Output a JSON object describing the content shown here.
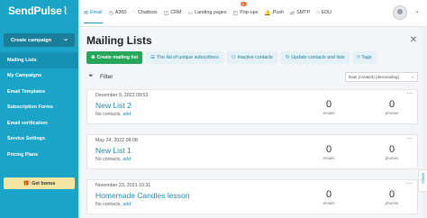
{
  "sidebar": {
    "logo": "SendPulse",
    "create_campaign": "Create campaign",
    "items": [
      {
        "label": "Mailing Lists",
        "active": true
      },
      {
        "label": "My Campaigns",
        "active": false
      },
      {
        "label": "Email Templates",
        "active": false
      },
      {
        "label": "Subscription Forms",
        "active": false
      },
      {
        "label": "Email verification",
        "active": false
      },
      {
        "label": "Service Settings",
        "active": false
      },
      {
        "label": "Pricing Plans",
        "active": false
      }
    ],
    "bonus": "Get bonus"
  },
  "topnav": {
    "items": [
      {
        "label": "Email",
        "icon": "envelope-icon",
        "active": true
      },
      {
        "label": "A360",
        "icon": "a360-icon",
        "active": false
      },
      {
        "label": "Chatbots",
        "icon": "chat-icon",
        "active": false
      },
      {
        "label": "CRM",
        "icon": "crm-icon",
        "active": false
      },
      {
        "label": "Landing pages",
        "icon": "page-icon",
        "active": false
      },
      {
        "label": "Pop-ups",
        "icon": "popup-icon",
        "active": false,
        "badge": "2"
      },
      {
        "label": "Push",
        "icon": "bell-icon",
        "active": false
      },
      {
        "label": "SMTP",
        "icon": "smtp-icon",
        "active": false
      },
      {
        "label": "EDU",
        "icon": "edu-icon",
        "active": false
      }
    ]
  },
  "main": {
    "title": "Mailing Lists",
    "buttons": {
      "create": "Create mailing list",
      "unique": "The list of unique subscribers",
      "inactive": "Inactive contacts",
      "update": "Update contacts and lists",
      "tags": "Tags"
    },
    "filter_label": "Filter",
    "sort_value": "Date (created) (descending)",
    "emails_label": "emails",
    "phones_label": "phones",
    "no_contacts": "No contacts,",
    "add_label": "add",
    "lists": [
      {
        "date": "December 9, 2022 09:53",
        "name": "New List 2",
        "emails": "0",
        "phones": "0"
      },
      {
        "date": "May 24, 2022 08:08",
        "name": "New List 1",
        "emails": "0",
        "phones": "0"
      },
      {
        "date": "November 23, 2021 10:31",
        "name": "Homemade Candles lesson",
        "emails": "0",
        "phones": "0"
      }
    ]
  },
  "chats_label": "Chats",
  "colors": {
    "sidebar": "#1aa5c8",
    "accent": "#1a8fb3",
    "primary_button": "#26a65b"
  }
}
